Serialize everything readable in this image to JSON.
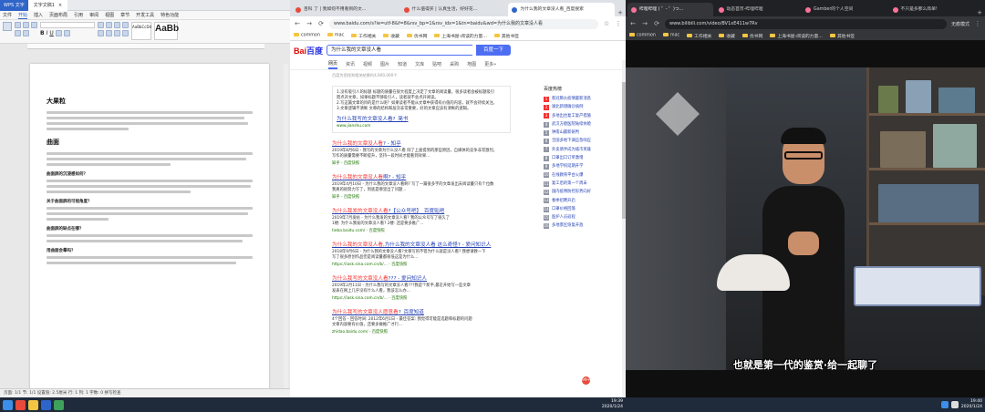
{
  "wps": {
    "app_tab": "WPS 文字",
    "doc_tab": "文字文稿1",
    "menu": [
      "文件",
      "开始",
      "插入",
      "页面布局",
      "引用",
      "审阅",
      "视图",
      "章节",
      "开发工具",
      "特色功能"
    ],
    "menu_active": "开始",
    "style_preview_label": "AaBbCcDd",
    "style_big_label": "AaBb",
    "doc": {
      "heading1": "大果粒",
      "heading2": "曲面",
      "subheads": [
        "曲面屏的沉浸感如何？",
        "关于曲面屏的可视角度？",
        "曲面屏的缺点在哪？",
        "用曲面会晕吗？"
      ]
    },
    "status": "页面: 1/1    节: 1/1    设置值: 2.5厘米    行: 1    列: 1    字数: 0    拼写检查"
  },
  "chrome_mid": {
    "tabs": [
      {
        "label": "百科 了 | 我如何不用看到的文...",
        "color": "#e94a3b"
      },
      {
        "label": "什么值得买 | 认真生活，好好花...",
        "color": "#e94a3b"
      },
      {
        "label": "为什么我的文章没人看_百度搜索",
        "color": "#2f64c8"
      }
    ],
    "url": "www.baidu.com/s?ie=utf-8&f=8&rsv_bp=1&rsv_idx=1&tn=baidu&wd=为什么我的文章没人看",
    "bookmarks": [
      "common",
      "mac",
      "工作相关",
      "收藏",
      "优书网",
      "上海书屋-阅读的力量...",
      "其他书签"
    ],
    "search": {
      "logo_left": "Bai",
      "logo_right": "百度",
      "query": "为什么我的文章没人看",
      "button": "百度一下",
      "tabs": [
        "网页",
        "资讯",
        "视频",
        "图片",
        "知道",
        "文库",
        "贴吧",
        "采购",
        "地图",
        "更多»"
      ],
      "active_tab": "网页",
      "result_count": "百度为您找到相关结果约4,900,000个"
    },
    "answer_box": {
      "lines": [
        "1.没有吸引人的标题 标题的质量在很大程度上决定了文章的阅读量，很多读者会被标题吸引",
        "而点开文章，如果标题不够吸引人，读者就不会点开阅读。",
        "2.写这篇文章的目的是什么呢？如果读者不能从文章中获得有价值的内容，就不会持续关注。",
        "3.文章逻辑不清晰 文章的结构和层次非常重要，好的文章应该有清晰的逻辑。"
      ],
      "title": "为什么我写的文章没人看?_简书",
      "url": "www.jianshu.com"
    },
    "results": [
      {
        "title_pre": "",
        "title_hl": "为什么我的文章没人看",
        "title_post": "? - 知乎",
        "snippet": "2019年8月6日 - 我写的文章为什么没人看 除了上面提到的那些原因，自媒体的竞争非常激烈，",
        "snippet2": "写作的质量需要不断提升，坚持一段时间才能看到效果...",
        "url": "知乎 - 百度快照"
      },
      {
        "title_pre": "",
        "title_hl": "为什么我的文章没人看",
        "title_post": "啊? - 知乎",
        "snippet": "2019年4月10日 - 为什么我的文章没人看啊? 写了一篇很多字的文章发出去阅读量只有个位数",
        "snippet2": "我真的很努力写了，到底是哪里出了问题...",
        "url": "知乎 - 百度快照"
      },
      {
        "title_pre": "",
        "title_hl": "为什么我发的文章没人看",
        "title_post": "?【公众号吧】_百度贴吧",
        "snippet": "2019年7月发帖 - 为什么我发的文章没人看? 我的公众号写了很久了",
        "snippet2": "1楼: 为什么我发的文章没人看? 2楼: 还是要多推广...",
        "url": "tieba.baidu.com/ - 百度快照"
      },
      {
        "title_pre": "",
        "title_hl": "为什么我的文章没人看",
        "title_post": ",为什么我的文章没人看 这么奇怪? - 爱问知识人",
        "snippet": "2018年9月6日 - 为什么我的文章没人看?文章写的不错为什么就是没人看? 我想请教一下",
        "snippet2": "写了很多原创作品但是阅读量都很低这是为什么...",
        "url": "https://iask.sina.com.cn/b/... - 百度快照"
      },
      {
        "title_pre": "",
        "title_hl": "为什么我写的文章没人看",
        "title_post": "??? - 爱问知识人",
        "snippet": "2019年2月11日 - 为什么我写的文章没人看???我是个新手,最近开始写一些文章",
        "snippet2": "发表在网上几乎没有什么人看，我该怎么办...",
        "url": "https://iask.sina.com.cn/b/... - 百度快照"
      },
      {
        "title_pre": "",
        "title_hl": "为什么我写的文章没人愿意看",
        "title_post": "?_百度知道",
        "snippet": "4个回答 - 回答时间: 2012年6月1日 - 最佳答案: 我觉得可能是选题和标题的问题",
        "snippet2": "文章内容要有价值，还要多做推广才行...",
        "url": "zhidao.baidu.com/ - 百度快照"
      }
    ],
    "hot": {
      "title": "百度热榜",
      "items": [
        "新冠肺炎疫情最新消息",
        "湖北新增确诊病例",
        "多地出台复工复产措施",
        "武汉方舱医院陆续休舱",
        "钟南山最新研判",
        "全国多地下调应急响应",
        "外卖骑手成为城市英雄",
        "口罩出口订单激增",
        "多地学校延期开学",
        "在线教育平台火爆",
        "复工后的第一个周末",
        "国内疫情防控形势向好",
        "春季招聘开启",
        "口罩价格回落",
        "医护人员返程",
        "多地景区恢复开放"
      ]
    },
    "badge": "99+"
  },
  "chrome_right": {
    "tabs": [
      {
        "label": "哔哩哔哩 ( ゜- ゜)つ...",
        "color": "#fb7299"
      },
      {
        "label": "动态首页-哔哩哔哩",
        "color": "#fb7299"
      },
      {
        "label": "Gamber的个人空间",
        "color": "#fb7299"
      },
      {
        "label": "不只是多那么简单!",
        "color": "#fb7299"
      }
    ],
    "url": "www.bilibili.com/video/BV1xE411w7Rv",
    "bookmarks": [
      "common",
      "mac",
      "工作相关",
      "收藏",
      "优书网",
      "上海书屋-阅读的力量...",
      "其他书签"
    ],
    "incognito": "无痕模式",
    "subtitle": "也就是第一代的鉴赏·给一起聊了"
  },
  "taskbar": {
    "time": "19:39",
    "date": "2020/1/24",
    "right_time": "19:40",
    "right_date": "2020/1/24"
  }
}
